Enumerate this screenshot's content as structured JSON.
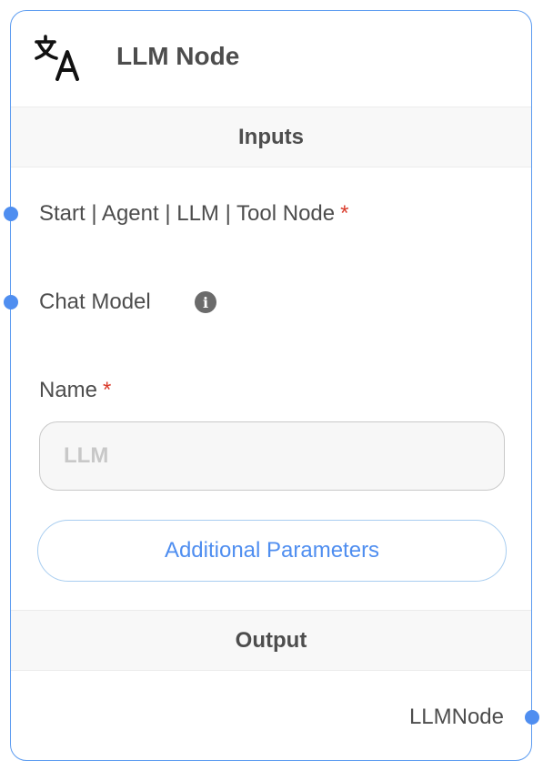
{
  "node": {
    "icon": "translate-icon",
    "title": "LLM Node"
  },
  "inputs": {
    "section_title": "Inputs",
    "anchors": [
      {
        "label": "Start | Agent | LLM | Tool Node",
        "required": "*"
      },
      {
        "label": "Chat Model",
        "info_icon": "info-icon"
      }
    ],
    "name_field": {
      "label": "Name",
      "required": "*",
      "placeholder": "LLM",
      "value": ""
    },
    "additional_parameters_label": "Additional Parameters"
  },
  "output": {
    "section_title": "Output",
    "label": "LLMNode"
  },
  "colors": {
    "accent": "#4f8ef0",
    "border": "#5b9bf0",
    "required": "#d93b2b"
  }
}
